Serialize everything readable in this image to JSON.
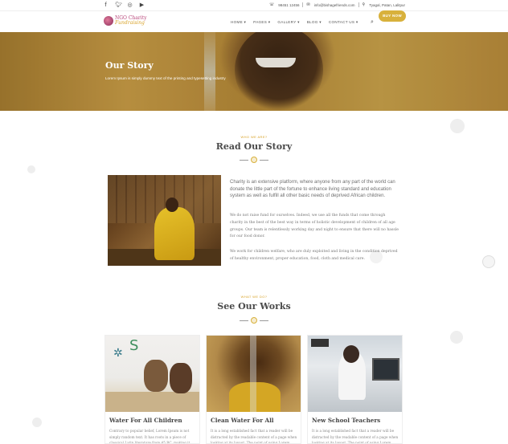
{
  "topbar": {
    "social_icons": [
      "facebook-icon",
      "twitter-icon",
      "instagram-icon",
      "youtube-icon"
    ],
    "phone": "98451 12456",
    "email": "info@bishagefriends.com",
    "address": "Tyagal, Patan, Lalitpur"
  },
  "nav": {
    "logo_line1": "NGO Charity",
    "logo_line2": "Fundraising",
    "menu": [
      "HOME",
      "PAGES",
      "GALLERY",
      "BLOG",
      "CONTACT US"
    ],
    "donate_label": "BUY NOW"
  },
  "hero": {
    "title": "Our Story",
    "subtitle": "Lorem Ipsum is simply dummy text of the printing and typesetting industry"
  },
  "story": {
    "eyebrow": "WHO WE ARE?",
    "title": "Read Our Story",
    "lead": "Charity is an extensive platform, where anyone from any part of the world can donate the little part of the fortune to enhance living standard and education system as well as fulfill all other basic needs of deprived African children.",
    "paragraphs": [
      "We do not raise fund for ourselves. Indeed, we use all the funds that come through charity in the best of the best way in terms of holistic development of children of all age groups. Our team is relentlessly working day and night to ensure that there will no hassle for our food donor.",
      "We work for children welfare, who are duly exploited and living in the condition deprived of healthy environment, proper education, food, cloth and medical care."
    ]
  },
  "works": {
    "eyebrow": "WHAT WE DO?",
    "title": "See Our Works",
    "cards": [
      {
        "title": "Water For All Children",
        "text": "Contrary to popular belief, Lorem Ipsum is not simply random text. It has roots in a piece of classical Latin literature from 45 BC, making it"
      },
      {
        "title": "Clean Water For All",
        "text": "It is a long established fact that a reader will be distracted by the readable content of a page when looking at its layout. The point of using Lorem"
      },
      {
        "title": "New School Teachers",
        "text": "It is a long established fact that a reader will be distracted by the readable content of a page when looking at its layout. The point of using Lorem"
      }
    ]
  },
  "colors": {
    "accent": "#d8b13c",
    "heading": "#4a4a4a",
    "logo": "#b8457a"
  }
}
